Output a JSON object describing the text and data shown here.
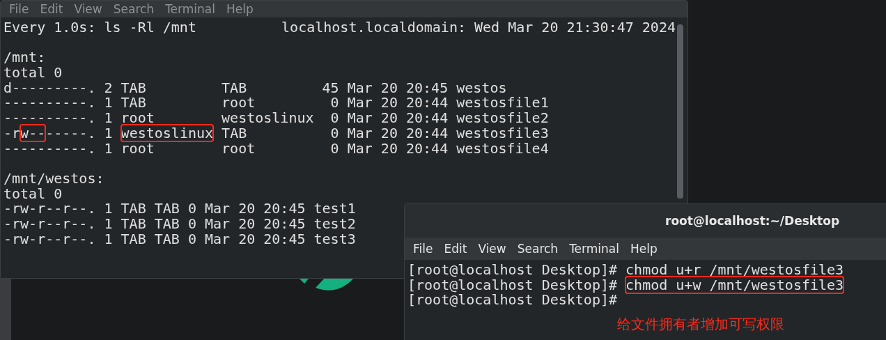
{
  "watch_window": {
    "active": false,
    "menu": [
      "File",
      "Edit",
      "View",
      "Search",
      "Terminal",
      "Help"
    ],
    "header": {
      "command": "Every 1.0s: ls -Rl /mnt",
      "host_time": "localhost.localdomain: Wed Mar 20 21:30:47 2024"
    },
    "lines": [
      {
        "kind": "blank"
      },
      {
        "kind": "text",
        "segments": [
          {
            "text": "/mnt:",
            "boxed": false
          }
        ]
      },
      {
        "kind": "text",
        "segments": [
          {
            "text": "total 0",
            "boxed": false
          }
        ]
      },
      {
        "kind": "text",
        "segments": [
          {
            "text": "d---------. 2 TAB         TAB         45 Mar 20 20:45 westos",
            "boxed": false
          }
        ]
      },
      {
        "kind": "text",
        "segments": [
          {
            "text": "----------. 1 TAB         root         0 Mar 20 20:44 westosfile1",
            "boxed": false
          }
        ]
      },
      {
        "kind": "text",
        "segments": [
          {
            "text": "----------. 1 root        westoslinux  0 Mar 20 20:44 westosfile2",
            "boxed": false
          }
        ]
      },
      {
        "kind": "text",
        "segments": [
          {
            "text": "-r",
            "boxed": false
          },
          {
            "text": "w--",
            "boxed": true
          },
          {
            "text": "-----. 1 ",
            "boxed": false
          },
          {
            "text": "westoslinux",
            "boxed": true
          },
          {
            "text": " TAB          0 Mar 20 20:44 westosfile3",
            "boxed": false
          }
        ]
      },
      {
        "kind": "text",
        "segments": [
          {
            "text": "----------. 1 root        root         0 Mar 20 20:44 westosfile4",
            "boxed": false
          }
        ]
      },
      {
        "kind": "blank"
      },
      {
        "kind": "text",
        "segments": [
          {
            "text": "/mnt/westos:",
            "boxed": false
          }
        ]
      },
      {
        "kind": "text",
        "segments": [
          {
            "text": "total 0",
            "boxed": false
          }
        ]
      },
      {
        "kind": "text",
        "segments": [
          {
            "text": "-rw-r--r--. 1 TAB TAB 0 Mar 20 20:45 test1",
            "boxed": false
          }
        ]
      },
      {
        "kind": "text",
        "segments": [
          {
            "text": "-rw-r--r--. 1 TAB TAB 0 Mar 20 20:45 test2",
            "boxed": false
          }
        ]
      },
      {
        "kind": "text",
        "segments": [
          {
            "text": "-rw-r--r--. 1 TAB TAB 0 Mar 20 20:45 test3",
            "boxed": false
          }
        ]
      }
    ]
  },
  "shell_window": {
    "active": true,
    "title": "root@localhost:~/Desktop",
    "menu": [
      "File",
      "Edit",
      "View",
      "Search",
      "Terminal",
      "Help"
    ],
    "lines": [
      {
        "kind": "text",
        "segments": [
          {
            "text": "[root@localhost Desktop]# chmod u+r /mnt/westosfile3",
            "boxed": false
          }
        ]
      },
      {
        "kind": "text",
        "segments": [
          {
            "text": "[root@localhost Desktop]# ",
            "boxed": false
          },
          {
            "text": "chmod u+w /mnt/westosfile3",
            "boxed": true
          }
        ]
      },
      {
        "kind": "text",
        "segments": [
          {
            "text": "[root@localhost Desktop]#",
            "boxed": false
          }
        ]
      }
    ]
  },
  "annotation": "给文件拥有者增加可写权限"
}
